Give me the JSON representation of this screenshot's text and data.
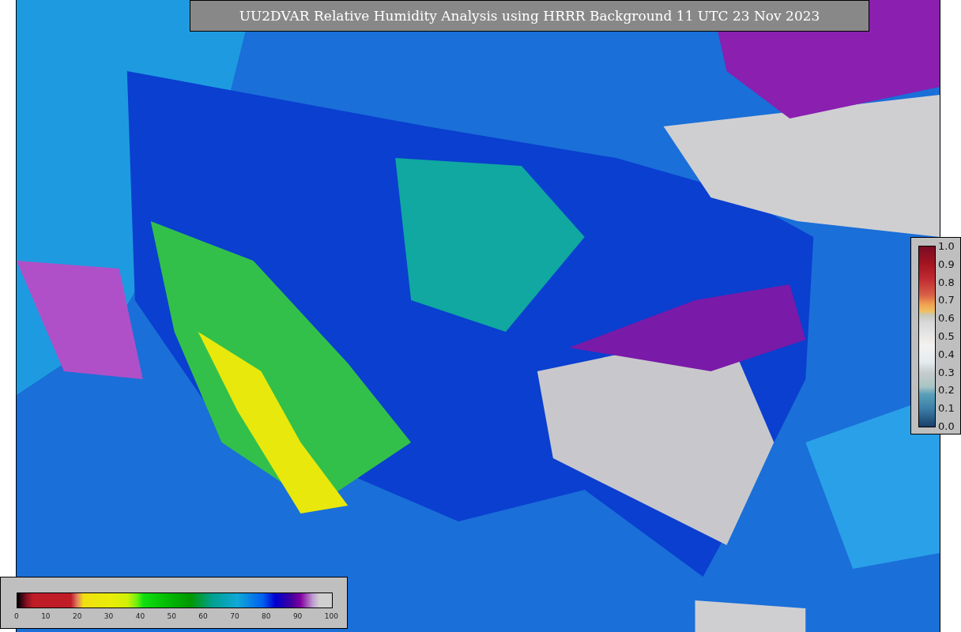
{
  "title": "UU2DVAR Relative Humidity Analysis using HRRR Background 11 UTC 23 Nov 2023",
  "station_colorbar": {
    "ticks": [
      "1.0",
      "0.9",
      "0.8",
      "0.7",
      "0.6",
      "0.5",
      "0.4",
      "0.3",
      "0.2",
      "0.1",
      "0.0"
    ]
  },
  "humidity_colorbar": {
    "ticks": [
      "0",
      "10",
      "20",
      "30",
      "40",
      "50",
      "60",
      "70",
      "80",
      "90",
      "100"
    ]
  }
}
